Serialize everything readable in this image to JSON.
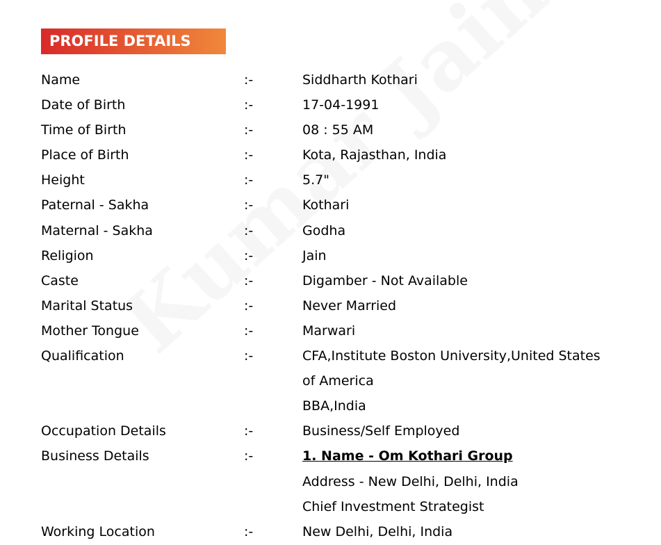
{
  "header": {
    "title": "PROFILE DETAILS"
  },
  "watermark": {
    "text": "Kumar Jain"
  },
  "separator": ":-",
  "rows": [
    {
      "label": "Name",
      "lines": [
        "Siddharth Kothari"
      ]
    },
    {
      "label": "Date of Birth",
      "lines": [
        "17-04-1991"
      ]
    },
    {
      "label": "Time of Birth",
      "lines": [
        "08 : 55 AM"
      ]
    },
    {
      "label": "Place of Birth",
      "lines": [
        "Kota, Rajasthan, India"
      ]
    },
    {
      "label": "Height",
      "lines": [
        "5.7\""
      ]
    },
    {
      "label": "Paternal - Sakha",
      "lines": [
        "Kothari"
      ]
    },
    {
      "label": "Maternal - Sakha",
      "lines": [
        "Godha"
      ]
    },
    {
      "label": "Religion",
      "lines": [
        "Jain"
      ]
    },
    {
      "label": "Caste",
      "lines": [
        "Digamber - Not Available"
      ]
    },
    {
      "label": "Marital Status",
      "lines": [
        "Never Married"
      ]
    },
    {
      "label": "Mother Tongue",
      "lines": [
        "Marwari"
      ]
    },
    {
      "label": "Qualification",
      "lines": [
        "CFA,Institute Boston University,United States",
        "of America",
        "BBA,India"
      ]
    },
    {
      "label": "Occupation Details",
      "lines": [
        "Business/Self Employed"
      ]
    },
    {
      "label": "Business Details",
      "lines": [
        "1. Name - Om Kothari Group",
        "Address - New Delhi, Delhi, India",
        "Chief Investment Strategist"
      ]
    },
    {
      "label": "Working Location",
      "lines": [
        "New Delhi, Delhi, India"
      ]
    }
  ]
}
